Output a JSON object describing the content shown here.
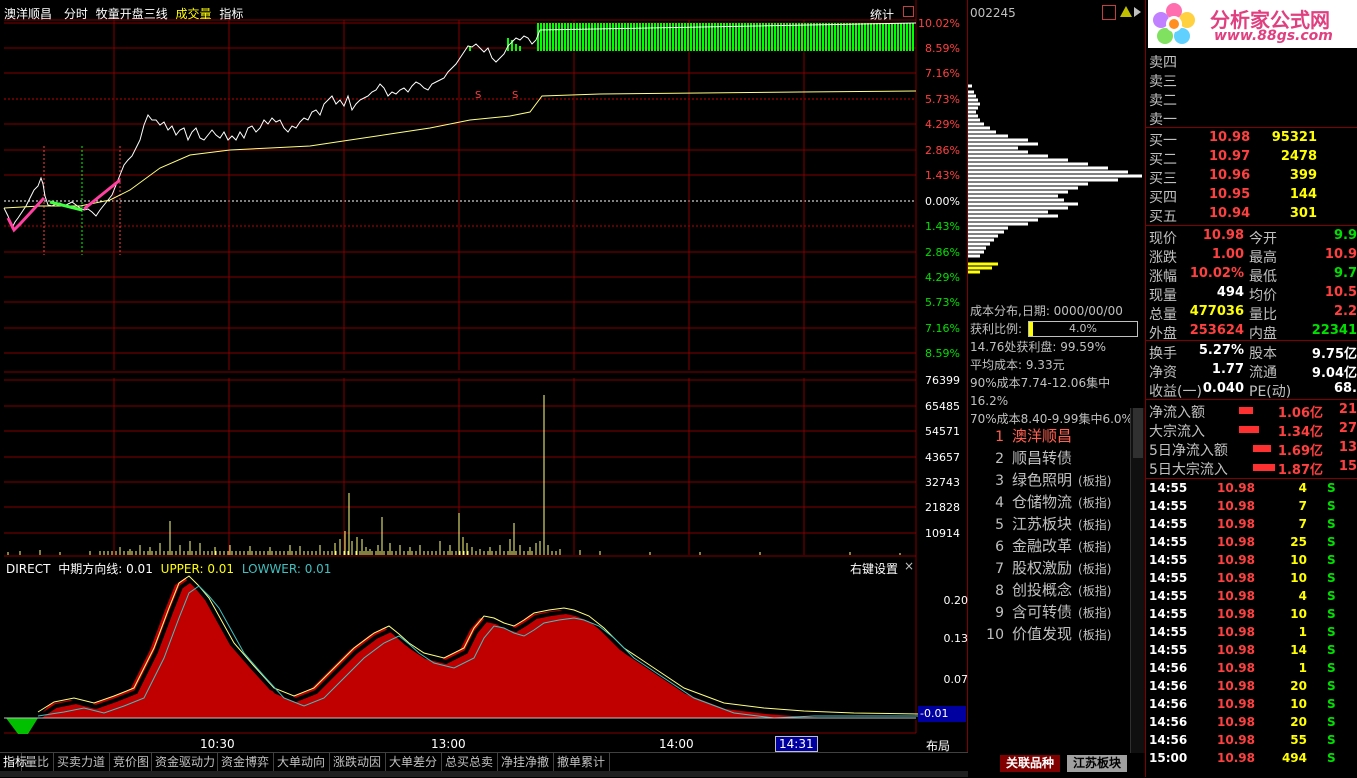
{
  "header": {
    "stock_name": "澳洋顺昌",
    "menu": [
      "分时",
      "牧童开盘三线",
      "成交量",
      "指标"
    ],
    "stat_label": "统计"
  },
  "price_axis": {
    "up": [
      "10.02%",
      "8.59%",
      "7.16%",
      "5.73%",
      "4.29%",
      "2.86%",
      "1.43%"
    ],
    "zero": "0.00%",
    "down": [
      "1.43%",
      "2.86%",
      "4.29%",
      "5.73%",
      "7.16%",
      "8.59%"
    ]
  },
  "volume_axis": [
    "76399",
    "65485",
    "54571",
    "43657",
    "32743",
    "21828",
    "10914"
  ],
  "indicator": {
    "name": "DIRECT",
    "line1": "中期方向线: 0.01",
    "upper": "UPPER: 0.01",
    "lower": "LOWWER: 0.01",
    "settings": "右键设置",
    "axis": [
      "0.20",
      "0.13",
      "0.07"
    ],
    "current": "-0.01"
  },
  "time_axis": {
    "t1": "10:30",
    "t2": "13:00",
    "t3": "14:00",
    "cursor": "14:31"
  },
  "chip": {
    "code": "002245",
    "title": "成本分布,日期:  0000/00/00",
    "profit_label": "获利比例:",
    "profit_value": "4.0%",
    "line1": "14.76处获利盘: 99.59%",
    "line2": "平均成本: 9.33元",
    "line3": "90%成本7.74-12.06集中16.2%",
    "line4": "70%成本8.40-9.99集中6.0%"
  },
  "related": [
    {
      "n": "1",
      "name": "澳洋顺昌",
      "tag": ""
    },
    {
      "n": "2",
      "name": "顺昌转债",
      "tag": ""
    },
    {
      "n": "3",
      "name": "绿色照明",
      "tag": "(板指)"
    },
    {
      "n": "4",
      "name": "仓储物流",
      "tag": "(板指)"
    },
    {
      "n": "5",
      "name": "江苏板块",
      "tag": "(板指)"
    },
    {
      "n": "6",
      "name": "金融改革",
      "tag": "(板指)"
    },
    {
      "n": "7",
      "name": "股权激励",
      "tag": "(板指)"
    },
    {
      "n": "8",
      "name": "创投概念",
      "tag": "(板指)"
    },
    {
      "n": "9",
      "name": "含可转债",
      "tag": "(板指)"
    },
    {
      "n": "10",
      "name": "价值发现",
      "tag": "(板指)"
    }
  ],
  "right_tabs": {
    "tab1": "关联品种",
    "tab2": "江苏板块"
  },
  "logo": {
    "text": "分析家公式网",
    "url": "www.88gs.com"
  },
  "sell_orders": [
    {
      "label": "卖四",
      "price": "",
      "vol": ""
    },
    {
      "label": "卖三",
      "price": "",
      "vol": ""
    },
    {
      "label": "卖二",
      "price": "",
      "vol": ""
    },
    {
      "label": "卖一",
      "price": "",
      "vol": ""
    }
  ],
  "buy_orders": [
    {
      "label": "买一",
      "price": "10.98",
      "vol": "95321"
    },
    {
      "label": "买二",
      "price": "10.97",
      "vol": "2478"
    },
    {
      "label": "买三",
      "price": "10.96",
      "vol": "399"
    },
    {
      "label": "买四",
      "price": "10.95",
      "vol": "144"
    },
    {
      "label": "买五",
      "price": "10.94",
      "vol": "301"
    }
  ],
  "quote": [
    {
      "l1": "现价",
      "v1": "10.98",
      "l2": "今开",
      "v2": "9.9"
    },
    {
      "l1": "涨跌",
      "v1": "1.00",
      "l2": "最高",
      "v2": "10.9"
    },
    {
      "l1": "涨幅",
      "v1": "10.02%",
      "l2": "最低",
      "v2": "9.7"
    },
    {
      "l1": "现量",
      "v1": "494",
      "l2": "均价",
      "v2": "10.5"
    },
    {
      "l1": "总量",
      "v1": "477036",
      "l2": "量比",
      "v2": "2.2"
    },
    {
      "l1": "外盘",
      "v1": "253624",
      "l2": "内盘",
      "v2": "22341"
    }
  ],
  "quote2": [
    {
      "l1": "换手",
      "v1": "5.27%",
      "l2": "股本",
      "v2": "9.75亿"
    },
    {
      "l1": "净资",
      "v1": "1.77",
      "l2": "流通",
      "v2": "9.04亿"
    },
    {
      "l1": "收益(一)",
      "v1": "0.040",
      "l2": "PE(动)",
      "v2": "68."
    }
  ],
  "fund_flow": [
    {
      "label": "净流入额",
      "value": "1.06亿",
      "extra": "21"
    },
    {
      "label": "大宗流入",
      "value": "1.34亿",
      "extra": "27"
    },
    {
      "label": "5日净流入额",
      "value": "1.69亿",
      "extra": "13"
    },
    {
      "label": "5日大宗流入",
      "value": "1.87亿",
      "extra": "15"
    }
  ],
  "ticks": [
    {
      "time": "14:55",
      "price": "10.98",
      "vol": "4",
      "side": "S"
    },
    {
      "time": "14:55",
      "price": "10.98",
      "vol": "7",
      "side": "S"
    },
    {
      "time": "14:55",
      "price": "10.98",
      "vol": "7",
      "side": "S"
    },
    {
      "time": "14:55",
      "price": "10.98",
      "vol": "25",
      "side": "S"
    },
    {
      "time": "14:55",
      "price": "10.98",
      "vol": "10",
      "side": "S"
    },
    {
      "time": "14:55",
      "price": "10.98",
      "vol": "10",
      "side": "S"
    },
    {
      "time": "14:55",
      "price": "10.98",
      "vol": "4",
      "side": "S"
    },
    {
      "time": "14:55",
      "price": "10.98",
      "vol": "10",
      "side": "S"
    },
    {
      "time": "14:55",
      "price": "10.98",
      "vol": "1",
      "side": "S"
    },
    {
      "time": "14:55",
      "price": "10.98",
      "vol": "14",
      "side": "S"
    },
    {
      "time": "14:56",
      "price": "10.98",
      "vol": "1",
      "side": "S"
    },
    {
      "time": "14:56",
      "price": "10.98",
      "vol": "20",
      "side": "S"
    },
    {
      "time": "14:56",
      "price": "10.98",
      "vol": "10",
      "side": "S"
    },
    {
      "time": "14:56",
      "price": "10.98",
      "vol": "20",
      "side": "S"
    },
    {
      "time": "14:56",
      "price": "10.98",
      "vol": "55",
      "side": "S"
    },
    {
      "time": "15:00",
      "price": "10.98",
      "vol": "494",
      "side": "S"
    }
  ],
  "bottom_tabs": [
    "指标",
    "量比",
    "买卖力道",
    "竞价图",
    "资金驱动力",
    "资金博弈",
    "大单动向",
    "涨跌动因",
    "大单差分",
    "总买总卖",
    "净挂净撤",
    "撤单累计"
  ],
  "layout_btn": "布局",
  "colors": {
    "up": "#ff4040",
    "down": "#00e000",
    "grid": "#800000",
    "price_line": "#ffffff",
    "avg_line": "#ffff80"
  }
}
